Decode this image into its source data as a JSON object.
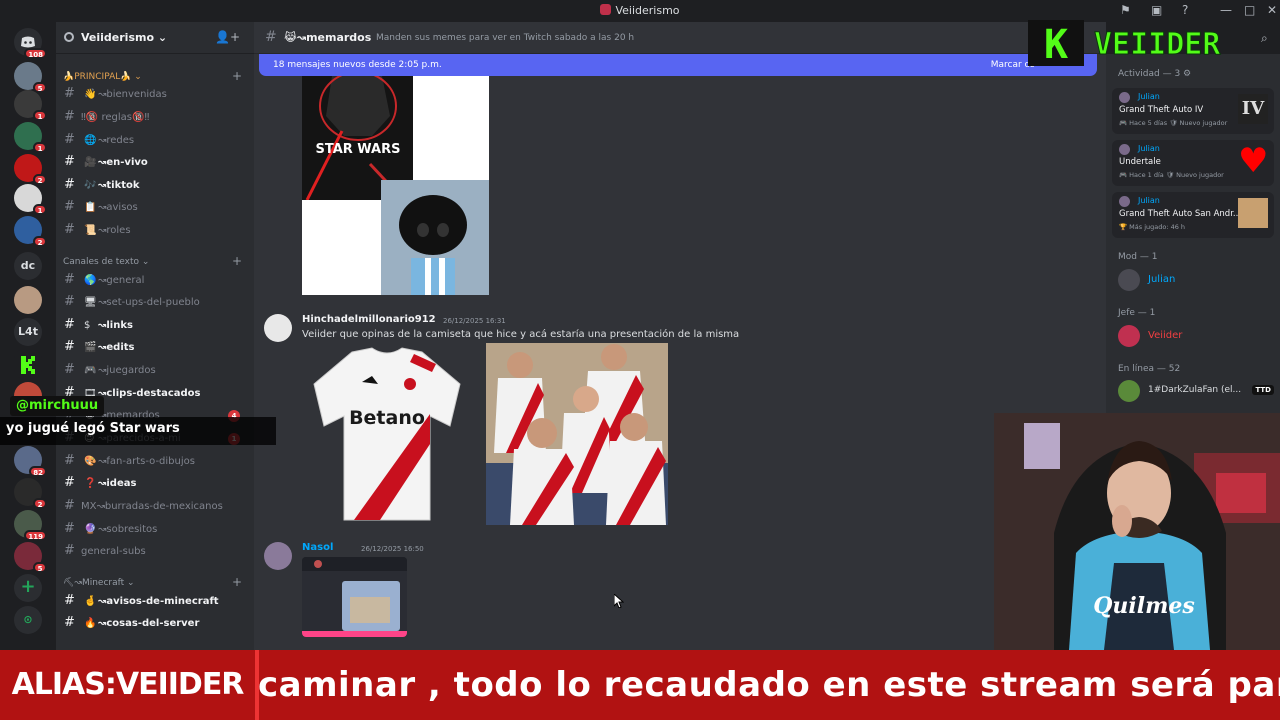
{
  "window": {
    "title": "Veiiderismo",
    "controls": [
      "—",
      "□",
      "✕"
    ]
  },
  "rail": {
    "home_badge": "108",
    "servers": [
      {
        "badge": "5",
        "color": "#6a7a8a"
      },
      {
        "badge": "1",
        "color": "#3a3a3a"
      },
      {
        "badge": "1",
        "color": "#2f6f4f"
      },
      {
        "badge": "2",
        "color": "#c01818"
      },
      {
        "badge": "1",
        "color": "#d8d8d8"
      },
      {
        "badge": "2",
        "color": "#2f5f9f"
      },
      {
        "badge": "82",
        "color": "#5a6a8a"
      },
      {
        "badge": "2",
        "color": "#2a2a2a"
      },
      {
        "badge": "119",
        "color": "#4a5a4a"
      },
      {
        "badge": "5",
        "color": "#7a2a3a"
      }
    ],
    "text_servers": [
      "dc",
      "L4t"
    ]
  },
  "guild": {
    "name": "Veiiderismo ⌄"
  },
  "categories": {
    "principal": "🍌PRINCIPAL🍌 ⌄",
    "texto": "Canales de texto ⌄",
    "minecraft": "⛏↝Minecraft ⌄"
  },
  "channels": [
    {
      "emoji": "👋",
      "label": "↝bienvenidas",
      "unread": false
    },
    {
      "emoji": "",
      "label": "‼🔞 reglas🔞‼",
      "unread": false
    },
    {
      "emoji": "🌐",
      "label": "↝redes",
      "unread": false
    },
    {
      "emoji": "🎥",
      "label": "↝en-vivo",
      "unread": true
    },
    {
      "emoji": "🎶",
      "label": "↝tiktok",
      "unread": true
    },
    {
      "emoji": "📋",
      "label": "↝avisos",
      "unread": false
    },
    {
      "emoji": "📜",
      "label": "↝roles",
      "unread": false
    },
    {
      "emoji": "🌎",
      "label": "↝general",
      "unread": false
    },
    {
      "emoji": "🖥",
      "label": "↝set-ups-del-pueblo",
      "unread": false
    },
    {
      "emoji": "$",
      "label": "↝links",
      "unread": true
    },
    {
      "emoji": "🎬",
      "label": "↝edits",
      "unread": true
    },
    {
      "emoji": "🎮",
      "label": "↝juegardos",
      "unread": false
    },
    {
      "emoji": "🎞",
      "label": "↝clips-destacados",
      "unread": true
    },
    {
      "emoji": "😹",
      "label": "↝memardos",
      "unread": false,
      "badge": "4"
    },
    {
      "emoji": "😍",
      "label": "↝parecidos-a-mi",
      "unread": false,
      "badge": "1"
    },
    {
      "emoji": "🎨",
      "label": "↝fan-arts-o-dibujos",
      "unread": false
    },
    {
      "emoji": "❓",
      "label": "↝ideas",
      "unread": true
    },
    {
      "emoji": "",
      "label": "MX↝burradas-de-mexicanos",
      "unread": false
    },
    {
      "emoji": "🔮",
      "label": "↝sobresitos",
      "unread": false
    },
    {
      "emoji": "",
      "label": "general-subs",
      "unread": false
    },
    {
      "emoji": "🤞",
      "label": "↝avisos-de-minecraft",
      "unread": true
    },
    {
      "emoji": "🔥",
      "label": "↝cosas-del-server",
      "unread": true
    }
  ],
  "chat": {
    "channel": "😹↝memardos",
    "topic": "Manden sus memes para ver en Twitch sabado a las 20 h",
    "new_banner": "18 mensajes nuevos desde 2:05 p.m.",
    "mark_read": "Marcar co",
    "messages": [
      {
        "user": "Hinchadelmillonario912",
        "time": "26/12/2025 16:31",
        "text": "Veiider que opinas de la camiseta que hice y acá estaría una presentación de la misma",
        "color": "#f2f3f5"
      },
      {
        "user": "Nasol",
        "time": "26/12/2025 16:50",
        "text": "",
        "color": "#00a8fc"
      }
    ],
    "image_texts": {
      "starwars": "STAR WARS",
      "sponsor": "Betano"
    }
  },
  "members": {
    "activity_title": "Actividad — 3 ⚙",
    "activities": [
      {
        "user": "Julian",
        "game": "Grand Theft Auto IV",
        "meta": "🎮 Hace 5 días  🛡 Nuevo jugador",
        "art": "IV"
      },
      {
        "user": "Julian",
        "game": "Undertale",
        "meta": "🎮 Hace 1 día  🛡 Nuevo jugador",
        "art": "♥"
      },
      {
        "user": "Julian",
        "game": "Grand Theft Auto San Andr...",
        "meta": "🏆 Más jugado: 46 h",
        "art": ""
      }
    ],
    "groups": [
      {
        "title": "Mod — 1",
        "member": "Julian",
        "color": "#00a8fc"
      },
      {
        "title": "Jefe — 1",
        "member": "Veiider",
        "color": "#f23f42"
      },
      {
        "title": "En línea — 52",
        "member": "1#DarkZulaFan (el...",
        "color": "#dbdee1",
        "tag": "TTD"
      }
    ]
  },
  "overlay": {
    "kick_letter": "K",
    "kick_name": "VEIIDER",
    "chat_user": "@mirchuuu",
    "chat_msg": "yo jugué legó Star wars",
    "alias": "ALIAS:VEIIDER",
    "ticker": "caminar , todo lo recaudado en este stream será para la o",
    "cam_shirt": "Quilmes"
  }
}
